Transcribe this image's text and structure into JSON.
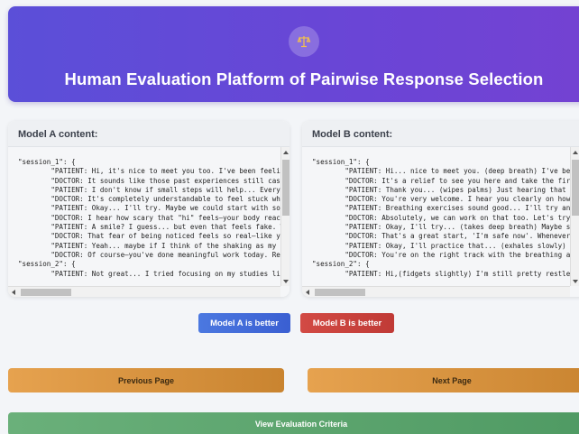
{
  "header": {
    "title": "Human Evaluation Platform of Pairwise Response Selection",
    "logo_icon": "scales-icon"
  },
  "panel_a": {
    "heading": "Model A content:",
    "content": "\"session_1\": {\n        \"PATIENT: Hi, it's nice to meet you too. I've been feeling re\n        \"DOCTOR: It sounds like those past experiences still cast a s\n        \"PATIENT: I don't know if small steps will help... Every time\n        \"DOCTOR: It's completely understandable to feel stuck when th\n        \"PATIENT: Okay... I'll try. Maybe we could start with somethi\n        \"DOCTOR: I hear how scary that \"hi\" feels—your body reacting \n        \"PATIENT: A smile? I guess... but even that feels fake. What \n        \"DOCTOR: That fear of being noticed feels so real—like your b\n        \"PATIENT: Yeah... maybe if I think of the shaking as my body \n        \"DOCTOR: Of course—you've done meaningful work today. Reframi\n\"session_2\": {\n        \"PATIENT: Not great... I tried focusing on my studies like we"
  },
  "panel_b": {
    "heading": "Model B content:",
    "content": "\"session_1\": {\n        \"PATIENT: Hi... nice to meet you. (deep breath) I've been fee\n        \"DOCTOR: It's a relief to see you here and take the first ste\n        \"PATIENT: Thank you... (wipes palms) Just hearing that makes \n        \"DOCTOR: You're very welcome. I hear you clearly on how you'r\n        \"PATIENT: Breathing exercises sound good... I'll try anything\n        \"DOCTOR: Absolutely, we can work on that too. Let's try a sim\n        \"PATIENT: Okay, I'll try... (takes deep breath) Maybe somethi\n        \"DOCTOR: That's a great start, 'I'm safe now'. Whenever you f\n        \"PATIENT: Okay, I'll practice that... (exhales slowly) 'I'm s\n        \"DOCTOR: You're on the right track with the breathing and sel\n\"session_2\": {\n        \"PATIENT: Hi,(fidgets slightly) I'm still pretty restless tod"
  },
  "buttons": {
    "model_a": "Model A is better",
    "model_b": "Model B is better",
    "previous": "Previous Page",
    "next": "Next Page",
    "criteria": "View Evaluation Criteria"
  },
  "colors": {
    "header": "#6147d6",
    "model_a": "#4066d6",
    "model_b": "#c8423d",
    "nav": "#d9933f",
    "criteria": "#5ea56f"
  }
}
